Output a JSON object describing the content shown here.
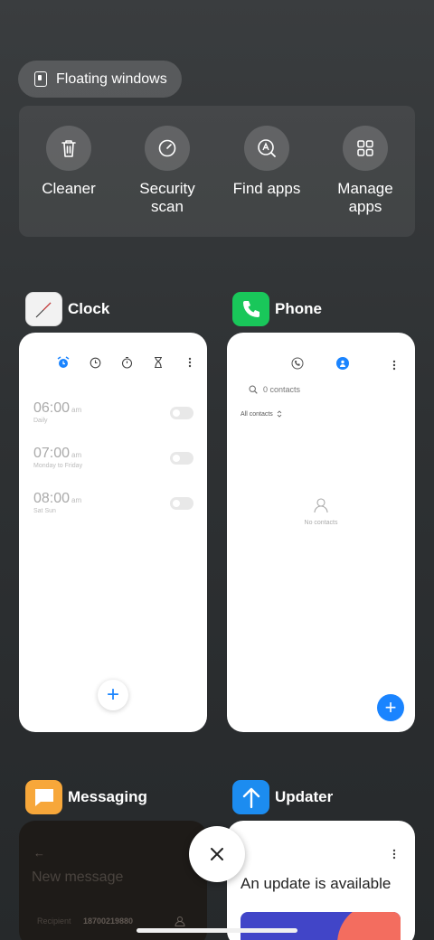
{
  "floating_windows": {
    "label": "Floating windows"
  },
  "tools": [
    {
      "label": "Cleaner",
      "icon": "trash-icon"
    },
    {
      "label": "Security\nscan",
      "icon": "security-scan-icon"
    },
    {
      "label": "Find apps",
      "icon": "find-apps-icon"
    },
    {
      "label": "Manage\napps",
      "icon": "grid-icon"
    }
  ],
  "apps": {
    "clock": {
      "name": "Clock",
      "alarms": [
        {
          "time": "06:00",
          "ampm": "am",
          "days": "Daily"
        },
        {
          "time": "07:00",
          "ampm": "am",
          "days": "Monday to Friday"
        },
        {
          "time": "08:00",
          "ampm": "am",
          "days": "Sat Sun"
        }
      ],
      "fab": "+"
    },
    "phone": {
      "name": "Phone",
      "search_text": "0 contacts",
      "filter": "All contacts",
      "empty_text": "No contacts",
      "fab": "+"
    },
    "messaging": {
      "name": "Messaging",
      "title": "New message",
      "recipient_label": "Recipient",
      "recipient_value": "18700219880"
    },
    "updater": {
      "name": "Updater",
      "headline": "An update is available"
    }
  },
  "colors": {
    "accent": "#1a84ff",
    "phone_icon": "#19c75a",
    "messaging_icon": "#f7a73a",
    "updater_icon": "#1c8cf0"
  }
}
